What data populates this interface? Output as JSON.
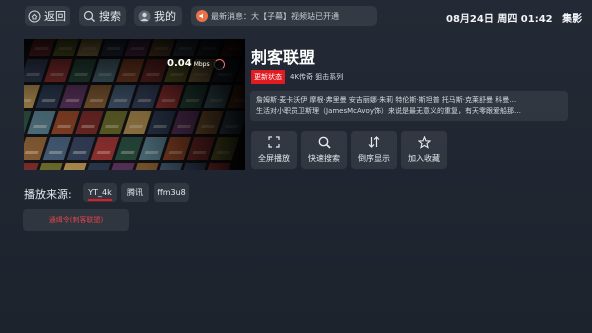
{
  "topbar": {
    "back": {
      "label": "返回",
      "icon": "back-icon"
    },
    "search": {
      "label": "搜索",
      "icon": "search-icon"
    },
    "mine": {
      "label": "我的",
      "icon": "user-icon"
    },
    "notice": {
      "text": "最新消息：大【子幕】视频站已开通",
      "icon": "speaker-icon"
    },
    "clock": "08月24日 周四 01:42",
    "brand": "集影"
  },
  "player": {
    "speed_value": "0.04",
    "speed_unit": "Mbps"
  },
  "detail": {
    "title": "刺客联盟",
    "badge": "更新状态",
    "meta": "4K传奇 狙击系列",
    "desc_line1": "詹姆斯·麦卡沃伊 摩根·弗里曼 安吉丽娜·朱莉 特伦斯·斯坦普 托马斯·克莱舒曼 科曼…",
    "desc_line2": "生活对小职员卫斯理（JamesMcAvoy饰）来说是最无意义的重复，有天零跟爱船那…"
  },
  "actions": [
    {
      "label": "全屏播放",
      "icon": "fullscreen-icon"
    },
    {
      "label": "快速搜索",
      "icon": "search-icon"
    },
    {
      "label": "倒序显示",
      "icon": "sort-icon"
    },
    {
      "label": "加入收藏",
      "icon": "star-icon"
    }
  ],
  "sources": {
    "label": "播放来源:",
    "tabs": [
      "YT_4k",
      "腾讯",
      "ffm3u8"
    ],
    "selected": "YT_4k"
  },
  "episode": {
    "label": "通缉令(刺客联盟)"
  },
  "colors": {
    "accent": "#e11b22",
    "background": "#1f2631"
  }
}
